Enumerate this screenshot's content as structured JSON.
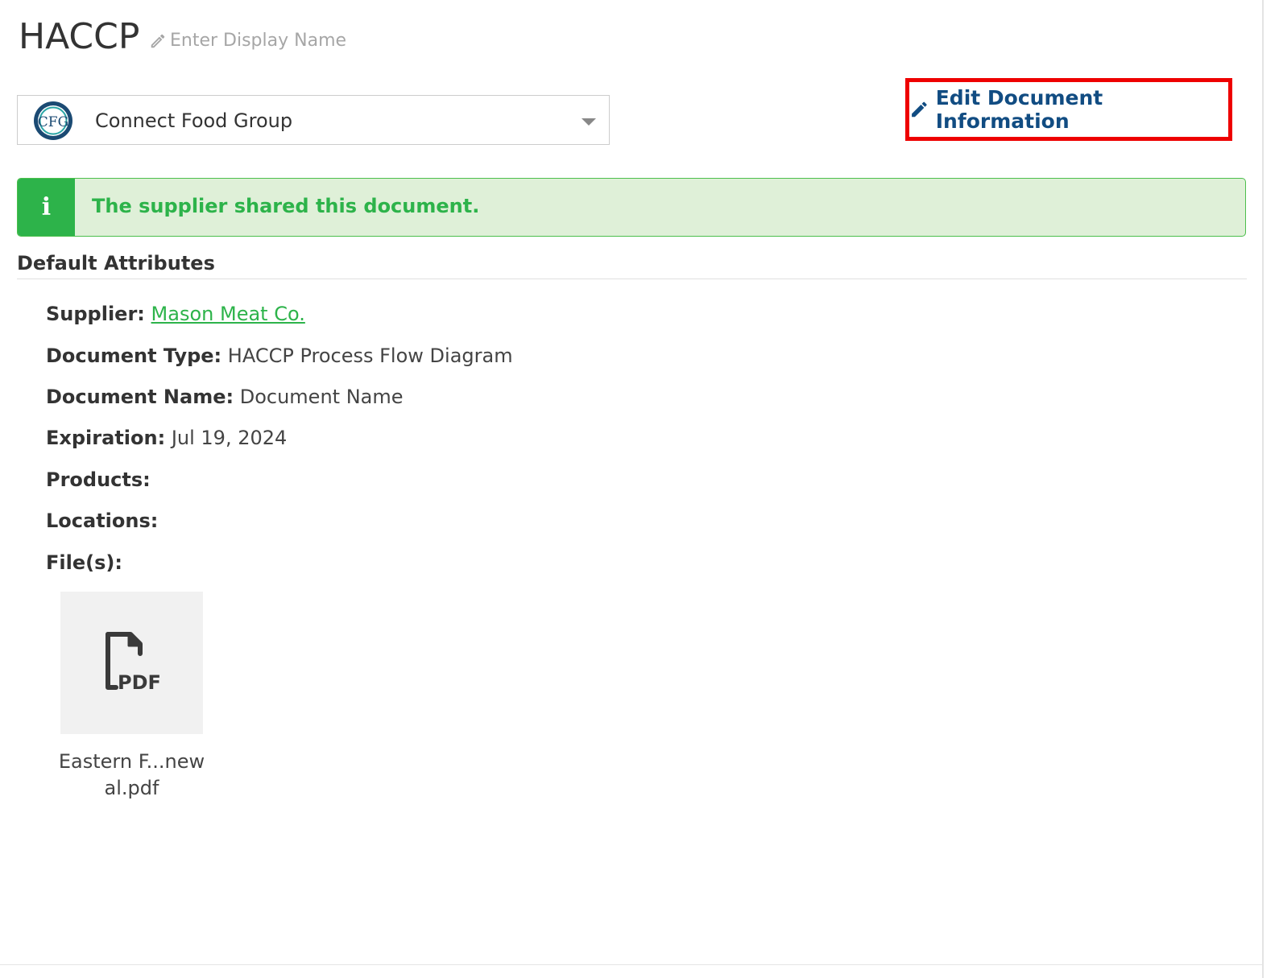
{
  "header": {
    "title": "HACCP",
    "display_name_placeholder": "Enter Display Name"
  },
  "company": {
    "logo_text": "CFG",
    "name": "Connect Food Group"
  },
  "toolbar": {
    "edit_label": "Edit Document Information"
  },
  "alert": {
    "icon": "i",
    "message": "The supplier shared this document."
  },
  "attributes": {
    "section_title": "Default Attributes",
    "supplier_label": "Supplier:",
    "supplier_value": "Mason Meat Co.",
    "document_type_label": "Document Type:",
    "document_type_value": "HACCP Process Flow Diagram",
    "document_name_label": "Document Name:",
    "document_name_value": "Document Name",
    "expiration_label": "Expiration:",
    "expiration_value": "Jul 19, 2024",
    "products_label": "Products:",
    "locations_label": "Locations:",
    "files_label": "File(s):"
  },
  "files": [
    {
      "type_label": "PDF",
      "name_line1": "Eastern F...new",
      "name_line2": "al.pdf"
    }
  ],
  "colors": {
    "accent_blue": "#114c82",
    "success_green": "#2db34a",
    "alert_bg": "#dff0d8",
    "highlight_red": "#ee0000"
  },
  "icons": {
    "display_name": "pencil-icon",
    "edit": "pencil-icon",
    "alert": "info-icon",
    "file": "pdf-file-icon",
    "select": "chevron-down-icon"
  }
}
